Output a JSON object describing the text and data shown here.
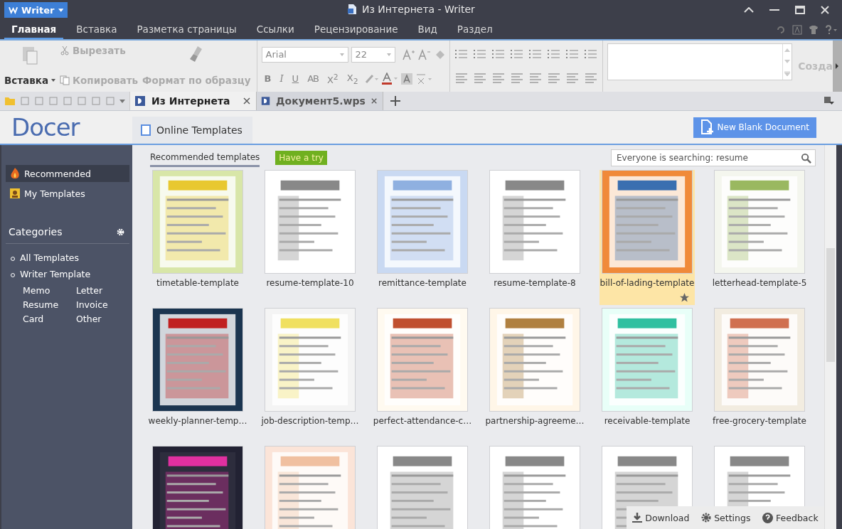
{
  "app_button": {
    "label": "Writer"
  },
  "window": {
    "title": "Из Интернета - Writer"
  },
  "menu_tabs": [
    {
      "label": "Главная",
      "selected": true
    },
    {
      "label": "Вставка",
      "selected": false
    },
    {
      "label": "Разметка страницы",
      "selected": false
    },
    {
      "label": "Ссылки",
      "selected": false
    },
    {
      "label": "Рецензирование",
      "selected": false
    },
    {
      "label": "Вид",
      "selected": false
    },
    {
      "label": "Раздел",
      "selected": false
    }
  ],
  "ribbon": {
    "paste": "Вставка",
    "cut": "Вырезать",
    "copy": "Копировать",
    "format_painter": "Формат по образцу",
    "font": "Arial",
    "size": "22",
    "format_buttons": [
      "B",
      "I",
      "U",
      "AB",
      "X$^{2}$",
      "X$_{2}$"
    ],
    "styles_label": "Созда"
  },
  "doc_tabs": [
    {
      "label": "Из Интернета",
      "selected": true
    },
    {
      "label": "Документ5.wps",
      "selected": false
    }
  ],
  "docer": {
    "logo": "Docer",
    "page_tab": "Online Templates",
    "new_button": "New Blank Document"
  },
  "sidebar": {
    "items": [
      {
        "label": "Recommended",
        "selected": true
      },
      {
        "label": "My Templates",
        "selected": false
      }
    ],
    "categories_title": "Categories",
    "categories": [
      {
        "label": "All Templates"
      },
      {
        "label": "Writer Template"
      }
    ],
    "subcategories": [
      "Memo",
      "Letter",
      "Resume",
      "Invoice",
      "Card",
      "Other"
    ]
  },
  "content": {
    "tab": "Recommended templates",
    "badge": "Have a try",
    "search": {
      "placeholder": "Everyone is searching: resume"
    }
  },
  "templates": [
    {
      "name": "timetable-template",
      "selected": false
    },
    {
      "name": "resume-template-10",
      "selected": false
    },
    {
      "name": "remittance-template",
      "selected": false
    },
    {
      "name": "resume-template-8",
      "selected": false
    },
    {
      "name": "bill-of-lading-template",
      "selected": true
    },
    {
      "name": "letterhead-template-5",
      "selected": false
    },
    {
      "name": "weekly-planner-temp…",
      "selected": false
    },
    {
      "name": "job-description-temp…",
      "selected": false
    },
    {
      "name": "perfect-attendance-c…",
      "selected": false
    },
    {
      "name": "partnership-agreeme…",
      "selected": false
    },
    {
      "name": "receivable-template",
      "selected": false
    },
    {
      "name": "free-grocery-template",
      "selected": false
    },
    {
      "selected": false
    },
    {
      "selected": false
    },
    {
      "selected": false
    },
    {
      "selected": false
    },
    {
      "selected": false
    },
    {
      "selected": false
    }
  ],
  "footer": [
    "Download",
    "Settings",
    "Feedback"
  ]
}
